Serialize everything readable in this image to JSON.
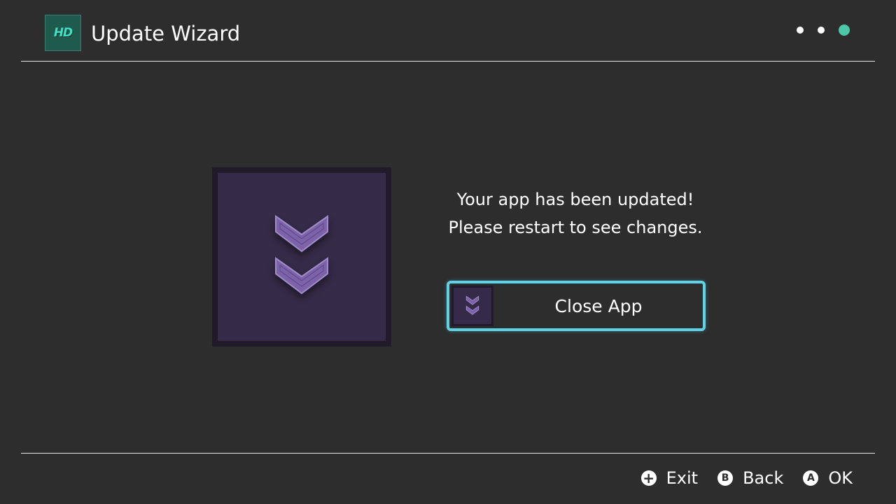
{
  "header": {
    "logo_text": "HD",
    "title": "Update Wizard",
    "steps_total": 3,
    "step_current": 3
  },
  "content": {
    "message_line1": "Your app has been updated!",
    "message_line2": "Please restart to see changes.",
    "close_button_label": "Close App"
  },
  "footer": {
    "controls": [
      {
        "glyph": "+",
        "label": "Exit"
      },
      {
        "glyph": "B",
        "label": "Back"
      },
      {
        "glyph": "A",
        "label": "OK"
      }
    ]
  },
  "colors": {
    "background": "#2d2d2d",
    "accent_step": "#4cc8a8",
    "focus_border": "#5ed2e6",
    "icon_tile": "#352a47",
    "icon_chevron": "#7b62a8"
  }
}
